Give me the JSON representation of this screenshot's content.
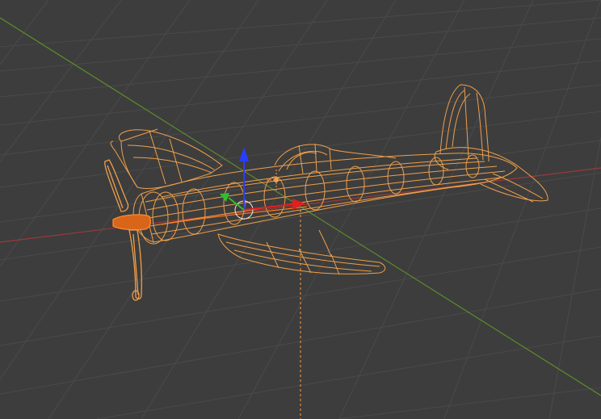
{
  "viewport": {
    "mode": "wireframe",
    "selected_object": "aircraft-model",
    "colors": {
      "background": "#3d3d3d",
      "grid_line": "#4a4a4a",
      "x_axis": "#9a3a3a",
      "y_axis": "#5c8c2e",
      "wire_selected": "#f0a04a",
      "wire_active": "#ff7a1a",
      "gizmo_z": "#2a3cff",
      "gizmo_y": "#2ec02e",
      "gizmo_x": "#e02020"
    },
    "icons": [
      "transform-gizmo",
      "3d-cursor",
      "origin-point"
    ]
  }
}
